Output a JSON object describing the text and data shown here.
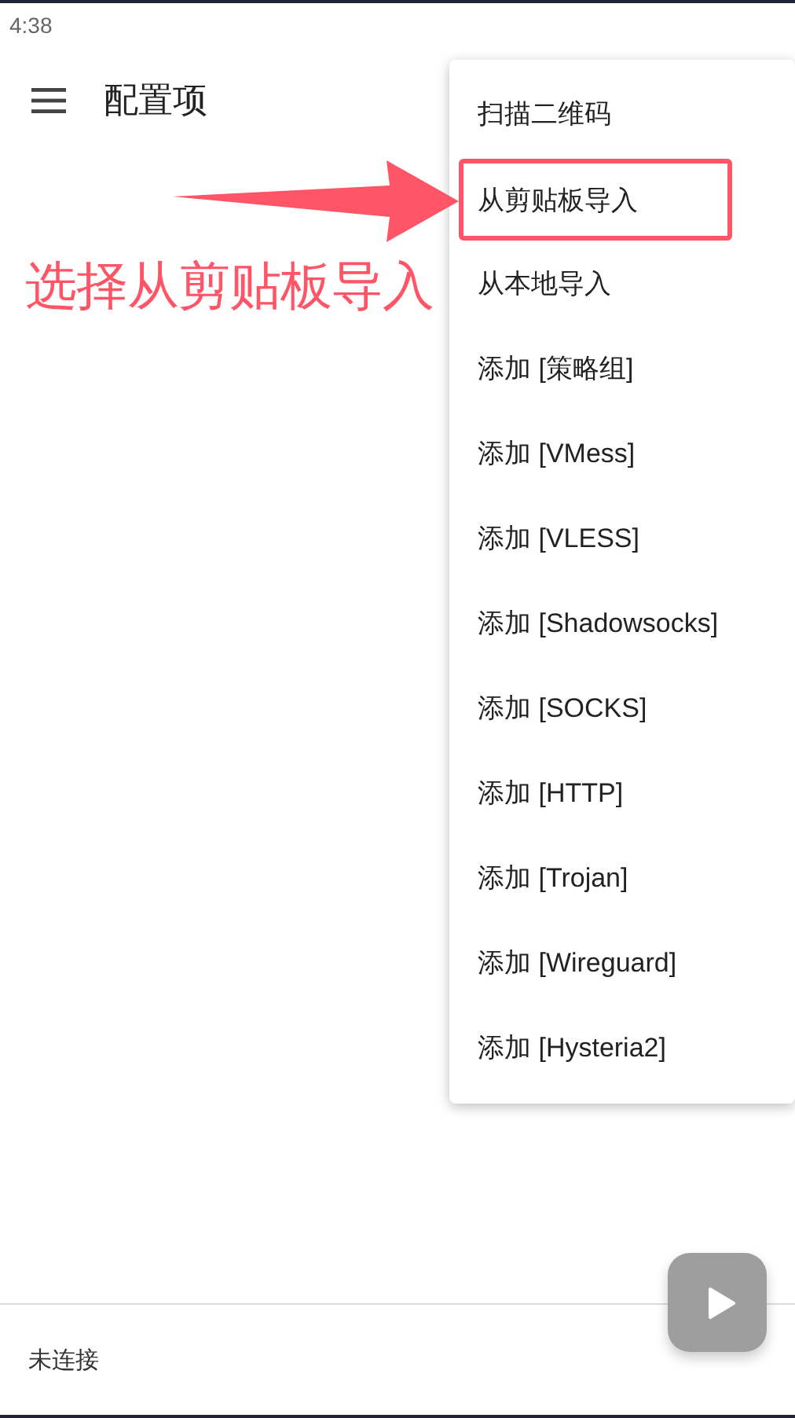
{
  "status_bar": {
    "time": "4:38"
  },
  "toolbar": {
    "title": "配置项"
  },
  "menu": {
    "items": [
      {
        "label": "扫描二维码",
        "highlighted": false
      },
      {
        "label": "从剪贴板导入",
        "highlighted": true
      },
      {
        "label": "从本地导入",
        "highlighted": false
      },
      {
        "label": "添加 [策略组]",
        "highlighted": false
      },
      {
        "label": "添加 [VMess]",
        "highlighted": false
      },
      {
        "label": "添加 [VLESS]",
        "highlighted": false
      },
      {
        "label": "添加 [Shadowsocks]",
        "highlighted": false
      },
      {
        "label": "添加 [SOCKS]",
        "highlighted": false
      },
      {
        "label": "添加 [HTTP]",
        "highlighted": false
      },
      {
        "label": "添加 [Trojan]",
        "highlighted": false
      },
      {
        "label": "添加 [Wireguard]",
        "highlighted": false
      },
      {
        "label": "添加 [Hysteria2]",
        "highlighted": false
      }
    ]
  },
  "annotation": {
    "text": "选择从剪贴板导入"
  },
  "bottom_bar": {
    "status": "未连接"
  }
}
